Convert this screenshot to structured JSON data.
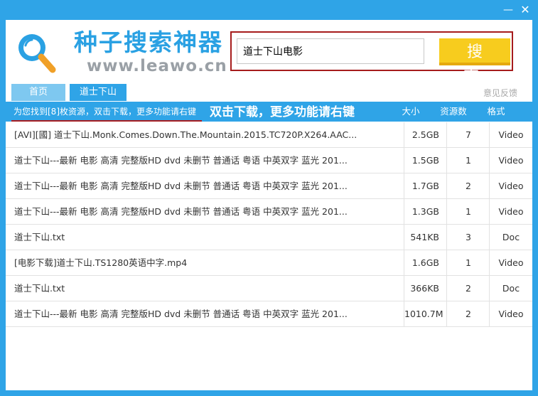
{
  "window": {
    "minimize_glyph": "—",
    "close_glyph": "✕"
  },
  "brand": {
    "title": "种子搜索神器",
    "url": "www.leawo.cn",
    "accent": "#2aa1e3"
  },
  "search": {
    "value": "道士下山电影",
    "button_label": "搜 索"
  },
  "tabs": [
    {
      "label": "首页"
    },
    {
      "label": "道士下山"
    }
  ],
  "feedback_label": "意见反馈",
  "results": {
    "info": "为您找到[8]枚资源，双击下载，更多功能请右键",
    "annotation": "双击下载，更多功能请右键",
    "columns": {
      "size": "大小",
      "count": "资源数",
      "type": "格式"
    }
  },
  "rows": [
    {
      "name": "[AVI][國] 道士下山.Monk.Comes.Down.The.Mountain.2015.TC720P.X264.AAC...",
      "size": "2.5GB",
      "count": "7",
      "type": "Video"
    },
    {
      "name": "道士下山---最新 电影 高清 完整版HD dvd 未删节 普通话 粤语 中英双字 蓝光 201...",
      "size": "1.5GB",
      "count": "1",
      "type": "Video"
    },
    {
      "name": "道士下山---最新 电影 高清 完整版HD dvd 未删节 普通话 粤语 中英双字 蓝光 201...",
      "size": "1.7GB",
      "count": "2",
      "type": "Video"
    },
    {
      "name": "道士下山---最新 电影 高清 完整版HD dvd 未删节 普通话 粤语 中英双字 蓝光 201...",
      "size": "1.3GB",
      "count": "1",
      "type": "Video"
    },
    {
      "name": "道士下山.txt",
      "size": "541KB",
      "count": "3",
      "type": "Doc"
    },
    {
      "name": "[电影下载]道士下山.TS1280英语中字.mp4",
      "size": "1.6GB",
      "count": "1",
      "type": "Video"
    },
    {
      "name": "道士下山.txt",
      "size": "366KB",
      "count": "2",
      "type": "Doc"
    },
    {
      "name": "道士下山---最新 电影 高清 完整版HD dvd 未删节 普通话 粤语 中英双字 蓝光 201...",
      "size": "1010.7M",
      "count": "2",
      "type": "Video"
    }
  ],
  "icons": {
    "logo": "magnifier-icon"
  },
  "colors": {
    "frame": "#2fa4e7",
    "search_button": "#f7cc1e",
    "highlight_border": "#a61c1c"
  }
}
